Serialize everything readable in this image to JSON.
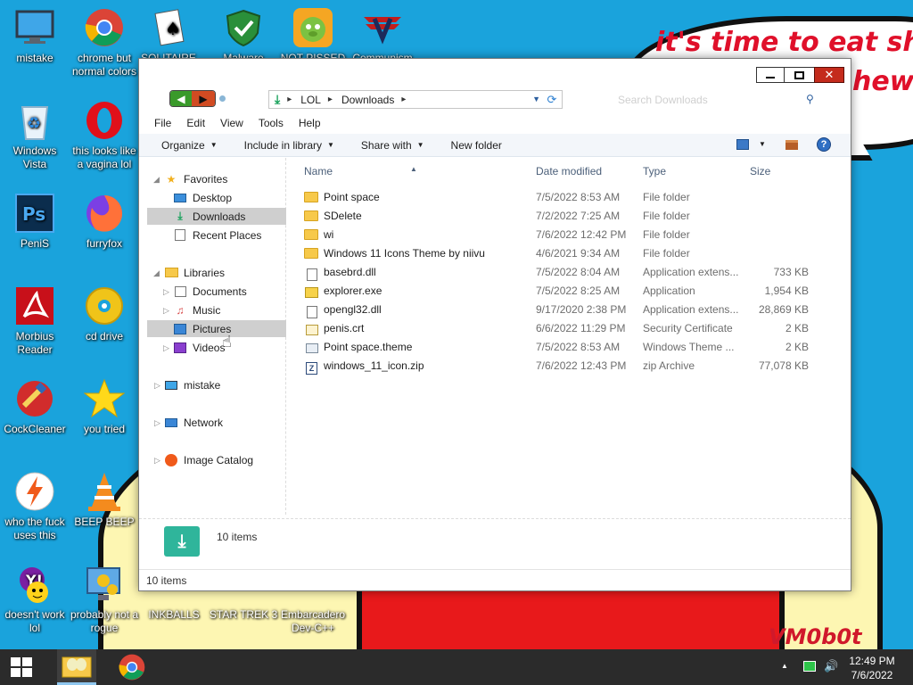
{
  "wallpaper": {
    "text_line1": "it's time to eat shit",
    "text_line2": "hew",
    "signature": "VM0b0t"
  },
  "desktop_icons": [
    {
      "label": "mistake",
      "icon": "monitor-icon"
    },
    {
      "label": "chrome but normal colors",
      "icon": "chrome-icon"
    },
    {
      "label": "SOLITAIRE",
      "icon": "solitaire-icon"
    },
    {
      "label": "Malware",
      "icon": "shield-icon"
    },
    {
      "label": "NOT PISSED",
      "icon": "angry-birds-icon"
    },
    {
      "label": "Communism",
      "icon": "emblem-icon"
    },
    {
      "label": "Windows Vista",
      "icon": "recycle-bin-icon"
    },
    {
      "label": "this looks like a vagina lol",
      "icon": "opera-icon"
    },
    {
      "label": "PeniS",
      "icon": "photoshop-icon"
    },
    {
      "label": "furryfox",
      "icon": "firefox-icon"
    },
    {
      "label": "Morbius Reader",
      "icon": "pdf-icon"
    },
    {
      "label": "cd drive",
      "icon": "cd-icon"
    },
    {
      "label": "CockCleaner",
      "icon": "ccleaner-icon"
    },
    {
      "label": "you tried",
      "icon": "star-icon"
    },
    {
      "label": "who the fuck uses this",
      "icon": "lightning-icon"
    },
    {
      "label": "BEEP BEEP",
      "icon": "vlc-icon"
    },
    {
      "label": "doesn't work lol",
      "icon": "yahoo-icon"
    },
    {
      "label": "probably not a rogue",
      "icon": "gear-monitor-icon"
    },
    {
      "label": "INKBALLS",
      "icon": "inkball-icon"
    },
    {
      "label": "STAR TREK 3",
      "icon": "star-trek-icon"
    },
    {
      "label": "Embarcadero Dev-C++",
      "icon": "devcpp-icon"
    }
  ],
  "explorer": {
    "address": {
      "crumb1": "LOL",
      "crumb2": "Downloads"
    },
    "search_placeholder": "Search Downloads",
    "menu": [
      "File",
      "Edit",
      "View",
      "Tools",
      "Help"
    ],
    "commands": {
      "organize": "Organize",
      "include": "Include in library",
      "share": "Share with",
      "new_folder": "New folder"
    },
    "nav": {
      "favorites": "Favorites",
      "desktop": "Desktop",
      "downloads": "Downloads",
      "recent": "Recent Places",
      "libraries": "Libraries",
      "documents": "Documents",
      "music": "Music",
      "pictures": "Pictures",
      "videos": "Videos",
      "mistake": "mistake",
      "network": "Network",
      "image_catalog": "Image Catalog"
    },
    "columns": {
      "name": "Name",
      "date": "Date modified",
      "type": "Type",
      "size": "Size"
    },
    "files": [
      {
        "name": "Point space",
        "date": "7/5/2022 8:53 AM",
        "type": "File folder",
        "size": "",
        "icon": "folder-icon"
      },
      {
        "name": "SDelete",
        "date": "7/2/2022 7:25 AM",
        "type": "File folder",
        "size": "",
        "icon": "folder-icon"
      },
      {
        "name": "wi",
        "date": "7/6/2022 12:42 PM",
        "type": "File folder",
        "size": "",
        "icon": "folder-icon"
      },
      {
        "name": "Windows 11 Icons Theme by niivu",
        "date": "4/6/2021 9:34 AM",
        "type": "File folder",
        "size": "",
        "icon": "folder-icon"
      },
      {
        "name": "basebrd.dll",
        "date": "7/5/2022 8:04 AM",
        "type": "Application extens...",
        "size": "733 KB",
        "icon": "dll-icon"
      },
      {
        "name": "explorer.exe",
        "date": "7/5/2022 8:25 AM",
        "type": "Application",
        "size": "1,954 KB",
        "icon": "exe-icon"
      },
      {
        "name": "opengl32.dll",
        "date": "9/17/2020 2:38 PM",
        "type": "Application extens...",
        "size": "28,869 KB",
        "icon": "dll-icon"
      },
      {
        "name": "penis.crt",
        "date": "6/6/2022 11:29 PM",
        "type": "Security Certificate",
        "size": "2 KB",
        "icon": "certificate-icon"
      },
      {
        "name": "Point space.theme",
        "date": "7/5/2022 8:53 AM",
        "type": "Windows Theme ...",
        "size": "2 KB",
        "icon": "theme-icon"
      },
      {
        "name": "windows_11_icon.zip",
        "date": "7/6/2022 12:43 PM",
        "type": "zip Archive",
        "size": "77,078 KB",
        "icon": "zip-icon"
      }
    ],
    "details_count": "10 items",
    "status_count": "10 items"
  },
  "taskbar": {
    "time": "12:49 PM",
    "date": "7/6/2022"
  }
}
